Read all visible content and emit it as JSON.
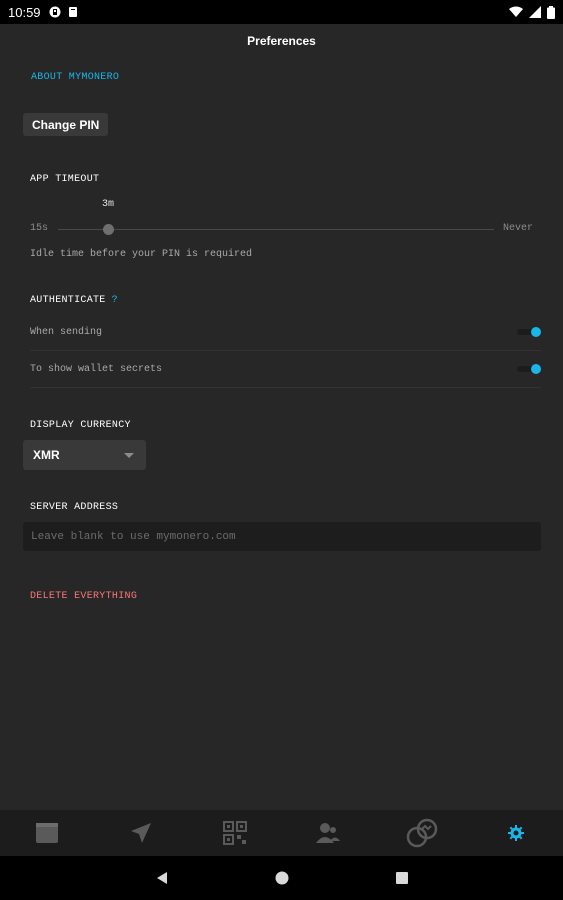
{
  "status_bar": {
    "time": "10:59",
    "icons": [
      "notification-icon",
      "clipboard-icon",
      "wifi-icon",
      "signal-icon",
      "battery-icon"
    ]
  },
  "header": {
    "title": "Preferences"
  },
  "about": {
    "label": "ABOUT MYMONERO"
  },
  "change_pin": {
    "label": "Change PIN"
  },
  "app_timeout": {
    "label": "APP TIMEOUT",
    "current_value": "3m",
    "min_label": "15s",
    "max_label": "Never",
    "level_fraction": 0.115,
    "help": "Idle time before your PIN is required"
  },
  "authenticate": {
    "label": "AUTHENTICATE",
    "help_icon": "?",
    "options": [
      {
        "label": "When sending",
        "on": true
      },
      {
        "label": "To show wallet secrets",
        "on": true
      }
    ]
  },
  "display_currency": {
    "label": "DISPLAY CURRENCY",
    "selected": "XMR"
  },
  "server_address": {
    "label": "SERVER ADDRESS",
    "value": "",
    "placeholder": "Leave blank to use mymonero.com"
  },
  "danger": {
    "delete_label": "DELETE EVERYTHING"
  },
  "tabs": [
    {
      "name": "wallets-tab",
      "icon": "wallet-icon",
      "active": false
    },
    {
      "name": "send-tab",
      "icon": "send-icon",
      "active": false
    },
    {
      "name": "request-tab",
      "icon": "qr-code-icon",
      "active": false
    },
    {
      "name": "contacts-tab",
      "icon": "contacts-icon",
      "active": false
    },
    {
      "name": "exchange-tab",
      "icon": "exchange-icon",
      "active": false
    },
    {
      "name": "settings-tab",
      "icon": "gear-icon",
      "active": true
    }
  ],
  "colors": {
    "accent": "#1ab6e8",
    "danger": "#f97777",
    "background": "#282728",
    "tab_inactive": "#5b5a5b"
  }
}
